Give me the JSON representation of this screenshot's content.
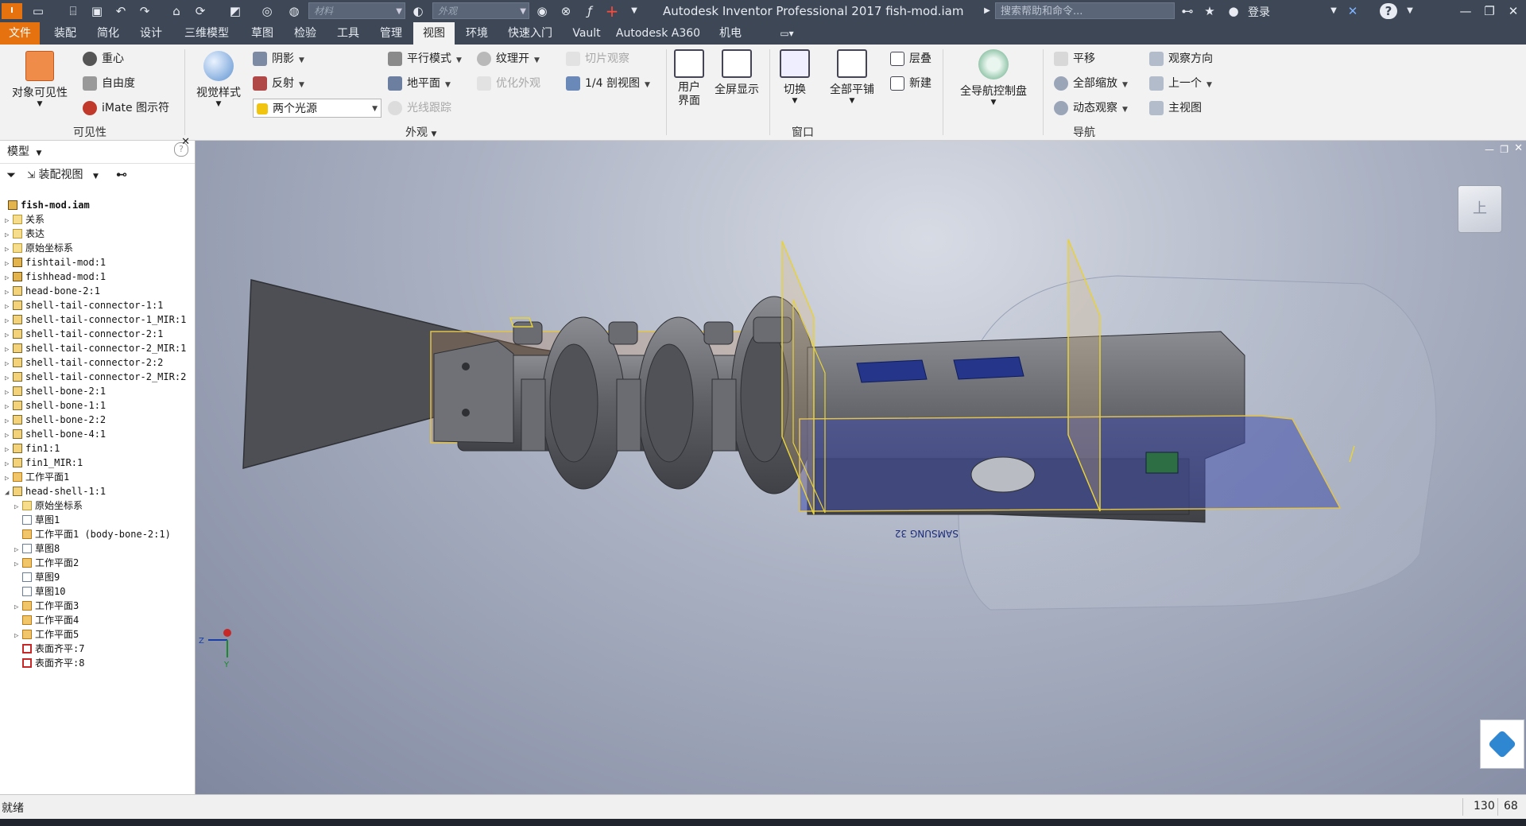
{
  "titlebar": {
    "app_title": "Autodesk Inventor Professional 2017    fish-mod.iam",
    "material_combo": "材料",
    "appearance_combo": "外观",
    "search_placeholder": "搜索帮助和命令...",
    "login": "登录"
  },
  "menu": {
    "tabs": [
      "文件",
      "装配",
      "简化",
      "设计",
      "三维模型",
      "草图",
      "检验",
      "工具",
      "管理",
      "视图",
      "环境",
      "快速入门",
      "Vault",
      "Autodesk A360",
      "机电"
    ],
    "active_tab": "视图"
  },
  "ribbon": {
    "visibility": {
      "title": "可见性",
      "object_visibility": "对象可见性",
      "center_of_gravity": "重心",
      "degrees_of_freedom": "自由度",
      "imate_glyph": "iMate 图示符"
    },
    "appearance": {
      "title": "外观",
      "visual_style": "视觉样式",
      "shadows": "阴影",
      "reflections": "反射",
      "lighting": "两个光源",
      "orthographic": "平行模式",
      "ground_plane": "地平面",
      "ray_tracing": "光线跟踪",
      "texture_on": "纹理开",
      "optimize_appearance": "优化外观",
      "slice_graphics": "切片观察",
      "quarter_section": "1/4 剖视图"
    },
    "window": {
      "title": "窗口",
      "user_interface": "用户\n界面",
      "clean_screen": "全屏显示",
      "switch": "切换",
      "tile_all": "全部平铺",
      "cascade": "层叠",
      "new": "新建",
      "full_nav_wheel": "全导航控制盘"
    },
    "navigate": {
      "title": "导航",
      "pan": "平移",
      "zoom_all": "全部缩放",
      "orbit": "动态观察",
      "look_at": "观察方向",
      "previous": "上一个",
      "home": "主视图"
    }
  },
  "browser": {
    "title": "模型",
    "view_label": "装配视图",
    "root": "fish-mod.iam",
    "items": [
      {
        "label": "关系",
        "type": "folder",
        "indent": 0,
        "toggle": "▷"
      },
      {
        "label": "表达",
        "type": "folder",
        "indent": 0,
        "toggle": "▷"
      },
      {
        "label": "原始坐标系",
        "type": "folder",
        "indent": 0,
        "toggle": "▷"
      },
      {
        "label": "fishtail-mod:1",
        "type": "asm",
        "indent": 0,
        "toggle": "▷"
      },
      {
        "label": "fishhead-mod:1",
        "type": "asm",
        "indent": 0,
        "toggle": "▷"
      },
      {
        "label": "head-bone-2:1",
        "type": "part",
        "indent": 0,
        "toggle": "▷"
      },
      {
        "label": "shell-tail-connector-1:1",
        "type": "part",
        "indent": 0,
        "toggle": "▷"
      },
      {
        "label": "shell-tail-connector-1_MIR:1",
        "type": "part",
        "indent": 0,
        "toggle": "▷"
      },
      {
        "label": "shell-tail-connector-2:1",
        "type": "part",
        "indent": 0,
        "toggle": "▷"
      },
      {
        "label": "shell-tail-connector-2_MIR:1",
        "type": "part",
        "indent": 0,
        "toggle": "▷"
      },
      {
        "label": "shell-tail-connector-2:2",
        "type": "part",
        "indent": 0,
        "toggle": "▷"
      },
      {
        "label": "shell-tail-connector-2_MIR:2",
        "type": "part",
        "indent": 0,
        "toggle": "▷"
      },
      {
        "label": "shell-bone-2:1",
        "type": "part",
        "indent": 0,
        "toggle": "▷"
      },
      {
        "label": "shell-bone-1:1",
        "type": "part",
        "indent": 0,
        "toggle": "▷"
      },
      {
        "label": "shell-bone-2:2",
        "type": "part",
        "indent": 0,
        "toggle": "▷"
      },
      {
        "label": "shell-bone-4:1",
        "type": "part",
        "indent": 0,
        "toggle": "▷"
      },
      {
        "label": "fin1:1",
        "type": "part",
        "indent": 0,
        "toggle": "▷"
      },
      {
        "label": "fin1_MIR:1",
        "type": "part",
        "indent": 0,
        "toggle": "▷"
      },
      {
        "label": "工作平面1",
        "type": "plane",
        "indent": 0,
        "toggle": "▷"
      },
      {
        "label": "head-shell-1:1",
        "type": "part",
        "indent": 0,
        "toggle": "◢"
      },
      {
        "label": "原始坐标系",
        "type": "folder",
        "indent": 1,
        "toggle": "▷"
      },
      {
        "label": "草图1",
        "type": "sketch",
        "indent": 1,
        "toggle": ""
      },
      {
        "label": "工作平面1 (body-bone-2:1)",
        "type": "plane",
        "indent": 1,
        "toggle": ""
      },
      {
        "label": "草图8",
        "type": "sketch",
        "indent": 1,
        "toggle": "▷"
      },
      {
        "label": "工作平面2",
        "type": "plane",
        "indent": 1,
        "toggle": "▷"
      },
      {
        "label": "草图9",
        "type": "sketch",
        "indent": 1,
        "toggle": ""
      },
      {
        "label": "草图10",
        "type": "sketch",
        "indent": 1,
        "toggle": ""
      },
      {
        "label": "工作平面3",
        "type": "plane",
        "indent": 1,
        "toggle": "▷"
      },
      {
        "label": "工作平面4",
        "type": "plane",
        "indent": 1,
        "toggle": ""
      },
      {
        "label": "工作平面5",
        "type": "plane",
        "indent": 1,
        "toggle": "▷"
      },
      {
        "label": "表面齐平:7",
        "type": "flush",
        "indent": 1,
        "toggle": ""
      },
      {
        "label": "表面齐平:8",
        "type": "flush",
        "indent": 1,
        "toggle": ""
      }
    ]
  },
  "viewport": {
    "board_label": "SAMSUNG 32",
    "triad_z": "Z",
    "triad_y": "Y",
    "viewcube_face": "上"
  },
  "status": {
    "text": "就绪",
    "count1": "130",
    "count2": "68"
  },
  "colors": {
    "title_bg": "#3d4756",
    "file_tab": "#e5720e",
    "work_plane": "#e8d23a",
    "model_gray": "#5b5d63"
  }
}
